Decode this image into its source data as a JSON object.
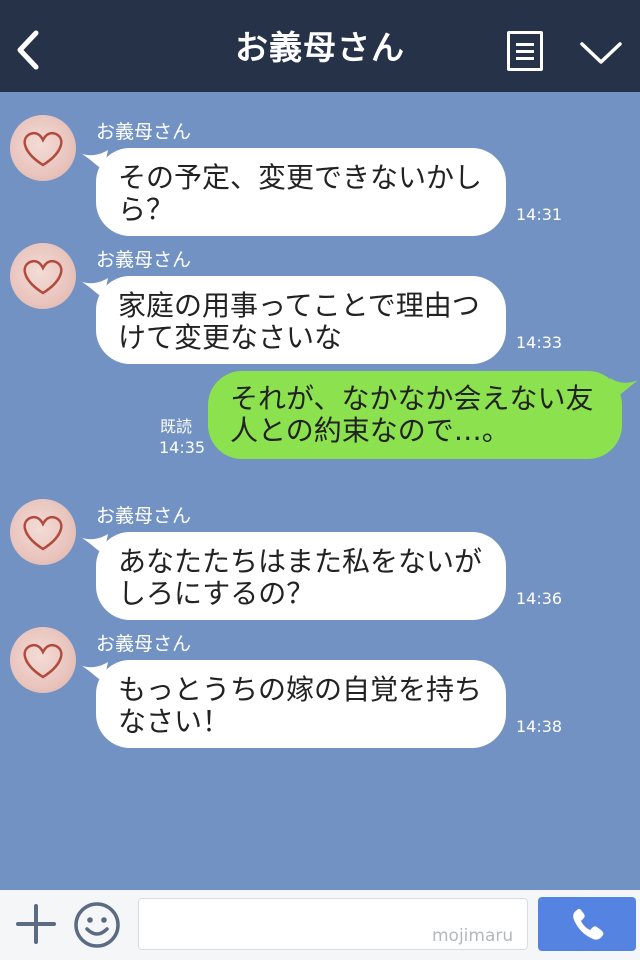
{
  "header": {
    "title": "お義母さん",
    "back_icon": "chevron-left-icon",
    "menu_icon": "menu-icon",
    "collapse_icon": "chevron-down-icon"
  },
  "messages": [
    {
      "direction": "in",
      "sender": "お義母さん",
      "text": "その予定、変更できないかしら？",
      "time": "14:31"
    },
    {
      "direction": "in",
      "sender": "お義母さん",
      "text": "家庭の用事ってことで理由つけて変更なさいな",
      "time": "14:33"
    },
    {
      "direction": "out",
      "text": "それが、なかなか会えない友人との約束なので…。",
      "read": "既読",
      "time": "14:35"
    },
    {
      "direction": "in",
      "sender": "お義母さん",
      "text": "あなたたちはまた私をないがしろにするの？",
      "time": "14:36"
    },
    {
      "direction": "in",
      "sender": "お義母さん",
      "text": "もっとうちの嫁の自覚を持ちなさい！",
      "time": "14:38"
    }
  ],
  "footer": {
    "plus_icon": "plus-icon",
    "emoji_icon": "smiley-icon",
    "input_value": "",
    "watermark": "mojimaru",
    "call_icon": "phone-icon"
  },
  "colors": {
    "header_bg": "#263247",
    "chat_bg": "#7192c2",
    "incoming_bubble": "#ffffff",
    "outgoing_bubble": "#8ce14f",
    "call_button": "#5583e1"
  }
}
